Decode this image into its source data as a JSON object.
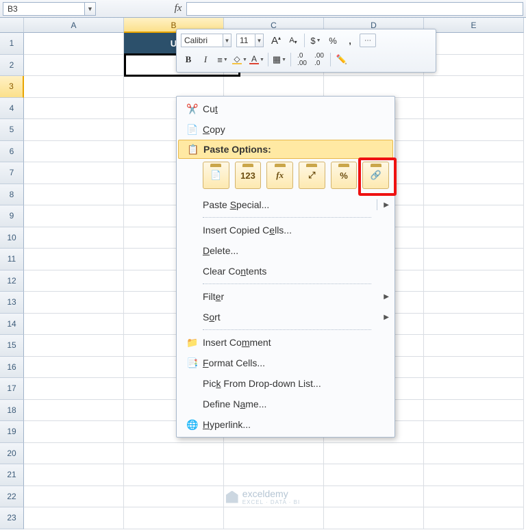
{
  "namebox": {
    "value": "B3"
  },
  "fx": {
    "label": "fx"
  },
  "columns": [
    "A",
    "B",
    "C",
    "D",
    "E"
  ],
  "selected_col_idx": 1,
  "rows": 23,
  "selected_row": 3,
  "header_cell": {
    "text": "U"
  },
  "mini_toolbar": {
    "font": "Calibri",
    "size": "11",
    "grow": "A",
    "shrink": "A",
    "currency": "$",
    "percent": "%",
    "comma": ",",
    "bold": "B",
    "italic": "I",
    "align": "≡",
    "fill": "◆",
    "font_color_letter": "A",
    "inc_dec": "⁺₀",
    "dec_dec": "⁻₀",
    "painter": "🖌"
  },
  "context_menu": {
    "cut": "Cut",
    "copy": "Copy",
    "paste_options": "Paste Options:",
    "paste_special": "Paste Special...",
    "insert_copied": "Insert Copied Cells...",
    "delete": "Delete...",
    "clear": "Clear Contents",
    "filter": "Filter",
    "sort": "Sort",
    "insert_comment": "Insert Comment",
    "format_cells": "Format Cells...",
    "pick_list": "Pick From Drop-down List...",
    "define_name": "Define Name...",
    "hyperlink": "Hyperlink...",
    "opts": {
      "values": "123",
      "formulas": "fx",
      "transpose": "⤢",
      "percent": "%",
      "link": "🔗"
    },
    "accel": {
      "cut": "t",
      "copy": "C",
      "special": "S",
      "insert": "E",
      "delete": "D",
      "clear": "N",
      "filter": "E",
      "sort": "O",
      "comment": "M",
      "format": "F",
      "pick": "K",
      "name": "A",
      "hyper": "H"
    }
  },
  "watermark": {
    "brand": "exceldemy",
    "tag": "EXCEL · DATA · BI"
  }
}
